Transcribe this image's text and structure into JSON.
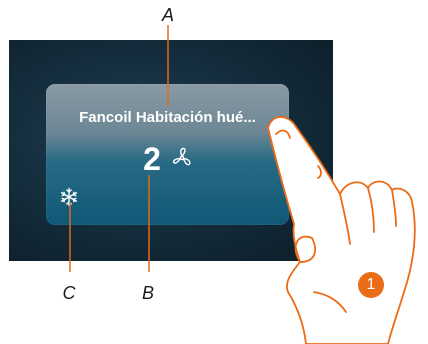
{
  "widget": {
    "title": "Fancoil Habitación hué...",
    "speed": "2",
    "icons": {
      "fan": "fan-icon",
      "mode": "snowflake-icon"
    }
  },
  "callouts": {
    "a": "A",
    "b": "B",
    "c": "C"
  },
  "step": {
    "number": "1"
  },
  "colors": {
    "accent": "#ea6c16",
    "leader": "#e06a1c"
  }
}
